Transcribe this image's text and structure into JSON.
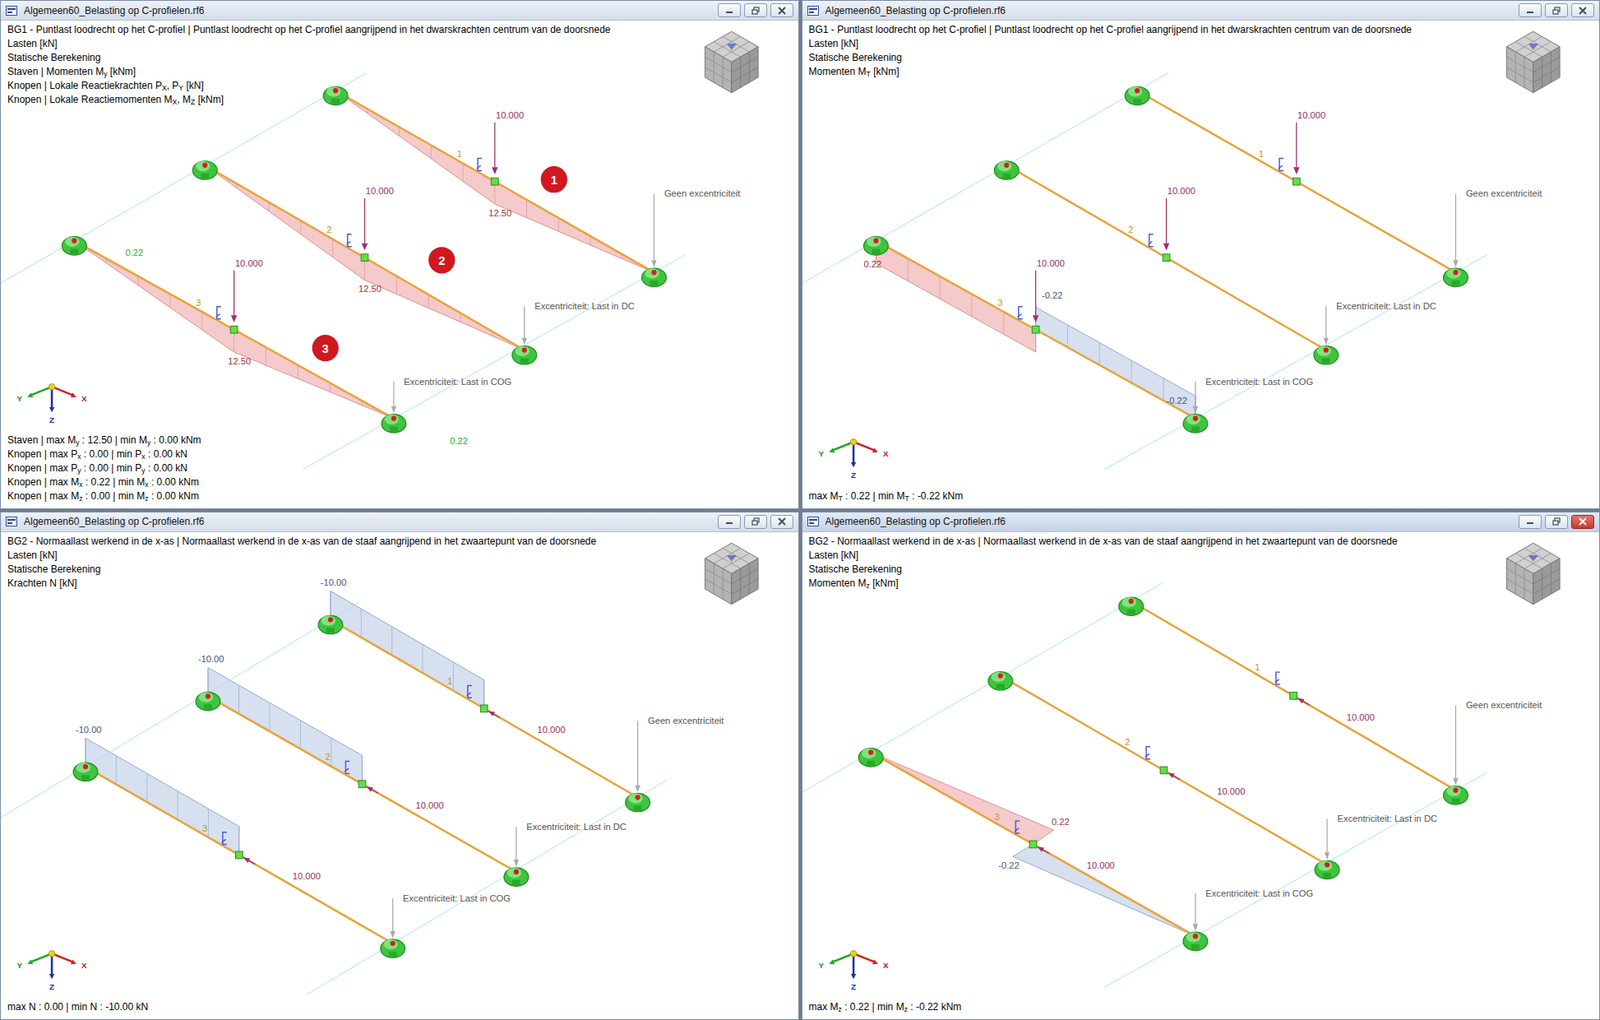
{
  "windows": [
    {
      "title": "Algemeen60_Belasting op C-profielen.rf6",
      "active": false,
      "headers": [
        [
          "BG1 - Puntlast loodrecht op het C-profiel | Puntlast loodrecht op het C-profiel aangrijpend in het dwarskrachten centrum van de doorsnede"
        ],
        [
          "Lasten [kN]"
        ],
        [
          "Statische Berekening"
        ],
        [
          "Staven | Momenten M",
          "y",
          " [kNm]"
        ],
        [
          "Knopen | Lokale Reactiekrachten P",
          "X",
          ", P",
          "Y",
          " [kN]"
        ],
        [
          "Knopen | Lokale Reactiemomenten M",
          "X",
          ", M",
          "Z",
          " [kNm]"
        ]
      ],
      "diagram_kind": "sag",
      "load_kind": "vertical",
      "members": [
        {
          "number": "1",
          "load": "10.000",
          "eccentricity": "Geen excentriciteit",
          "parts": [
            {
              "negative": false,
              "color": "#f2b8b8",
              "labels": [
                "12.50"
              ]
            }
          ]
        },
        {
          "number": "2",
          "load": "10.000",
          "eccentricity": "Excentriciteit: Last in DC",
          "parts": [
            {
              "negative": false,
              "color": "#f2b8b8",
              "labels": [
                "12.50"
              ]
            }
          ]
        },
        {
          "number": "3",
          "load": "10.000",
          "eccentricity": "Excentriciteit: Last in COG",
          "parts": [
            {
              "negative": false,
              "color": "#f2b8b8",
              "labels": [
                "12.50"
              ]
            }
          ]
        }
      ],
      "reactions": [
        "0.22",
        "0.22"
      ],
      "callouts": [
        "1",
        "2",
        "3"
      ],
      "summary": [
        [
          "Staven | max M",
          "y",
          " : 12.50 | min M",
          "y",
          " : 0.00 kNm"
        ],
        [
          "Knopen | max P",
          "x",
          " : 0.00 | min P",
          "x",
          " : 0.00 kN"
        ],
        [
          "Knopen | max P",
          "y",
          " : 0.00 | min P",
          "y",
          " : 0.00 kN"
        ],
        [
          "Knopen | max M",
          "x",
          " : 0.22 | min M",
          "x",
          " : 0.00 kNm"
        ],
        [
          "Knopen | max M",
          "z",
          " : 0.00 | min M",
          "z",
          " : 0.00 kNm"
        ]
      ],
      "axes": {
        "x": "X",
        "y": "Y",
        "z": "Z"
      }
    },
    {
      "title": "Algemeen60_Belasting op C-profielen.rf6",
      "active": false,
      "headers": [
        [
          "BG1 - Puntlast loodrecht op het C-profiel | Puntlast loodrecht op het C-profiel aangrijpend in het dwarskrachten centrum van de doorsnede"
        ],
        [
          "Lasten [kN]"
        ],
        [
          "Statische Berekening"
        ],
        [
          "Momenten M",
          "T",
          " [kNm]"
        ]
      ],
      "diagram_kind": "band",
      "load_kind": "vertical",
      "members": [
        {
          "number": "1",
          "load": "10.000",
          "eccentricity": "Geen excentriciteit",
          "parts": []
        },
        {
          "number": "2",
          "load": "10.000",
          "eccentricity": "Excentriciteit: Last in DC",
          "parts": []
        },
        {
          "number": "3",
          "load": "10.000",
          "eccentricity": "Excentriciteit: Last in COG",
          "parts": [
            {
              "negative": false,
              "color": "#f2b8b8",
              "labels": [
                "0.22"
              ]
            },
            {
              "negative": true,
              "color": "#c8d6ea",
              "labels": [
                "-0.22",
                "-0.22"
              ]
            }
          ]
        }
      ],
      "reactions": [],
      "callouts": [],
      "summary": [
        [
          "max M",
          "T",
          " : 0.22 | min M",
          "T",
          " : -0.22 kNm"
        ]
      ],
      "axes": {
        "x": "X",
        "y": "Y",
        "z": "Z"
      }
    },
    {
      "title": "Algemeen60_Belasting op C-profielen.rf6",
      "active": false,
      "headers": [
        [
          "BG2 - Normaallast werkend in de x-as | Normaallast werkend in de x-as van de staaf aangrijpend in het zwaartepunt van de doorsnede"
        ],
        [
          "Lasten [kN]"
        ],
        [
          "Statische Berekening"
        ],
        [
          "Krachten N [kN]"
        ]
      ],
      "diagram_kind": "axial",
      "load_kind": "axial",
      "members": [
        {
          "number": "1",
          "load": "10.000",
          "eccentricity": "Geen excentriciteit",
          "parts": [
            {
              "negative": true,
              "color": "#c8d6ea",
              "labels": [
                "-10.00"
              ]
            }
          ]
        },
        {
          "number": "2",
          "load": "10.000",
          "eccentricity": "Excentriciteit: Last in DC",
          "parts": [
            {
              "negative": true,
              "color": "#c8d6ea",
              "labels": [
                "-10.00"
              ]
            }
          ]
        },
        {
          "number": "3",
          "load": "10.000",
          "eccentricity": "Excentriciteit: Last in COG",
          "parts": [
            {
              "negative": true,
              "color": "#c8d6ea",
              "labels": [
                "-10.00"
              ]
            }
          ]
        }
      ],
      "reactions": [],
      "callouts": [],
      "summary": [
        [
          "max N : 0.00 | min N : -10.00 kN"
        ]
      ],
      "axes": {
        "x": "X",
        "y": "Y",
        "z": "Z"
      }
    },
    {
      "title": "Algemeen60_Belasting op C-profielen.rf6",
      "active": true,
      "headers": [
        [
          "BG2 - Normaallast werkend in de x-as | Normaallast werkend in de x-as van de staaf aangrijpend in het zwaartepunt van de doorsnede"
        ],
        [
          "Lasten [kN]"
        ],
        [
          "Statische Berekening"
        ],
        [
          "Momenten M",
          "z",
          " [kNm]"
        ]
      ],
      "diagram_kind": "inplane",
      "load_kind": "axial",
      "members": [
        {
          "number": "1",
          "load": "10.000",
          "eccentricity": "Geen excentriciteit",
          "parts": []
        },
        {
          "number": "2",
          "load": "10.000",
          "eccentricity": "Excentriciteit: Last in DC",
          "parts": []
        },
        {
          "number": "3",
          "load": "10.000",
          "eccentricity": "Excentriciteit: Last in COG",
          "parts": [
            {
              "negative": false,
              "color": "#f2b8b8",
              "labels": [
                "0.22"
              ]
            },
            {
              "negative": true,
              "color": "#c8d6ea",
              "labels": [
                "-0.22"
              ]
            }
          ]
        }
      ],
      "reactions": [],
      "callouts": [],
      "summary": [
        [
          "max M",
          "z",
          " : 0.22 | min M",
          "z",
          " : -0.22 kNm"
        ]
      ],
      "axes": {
        "x": "X",
        "y": "Y",
        "z": "Z"
      }
    }
  ]
}
